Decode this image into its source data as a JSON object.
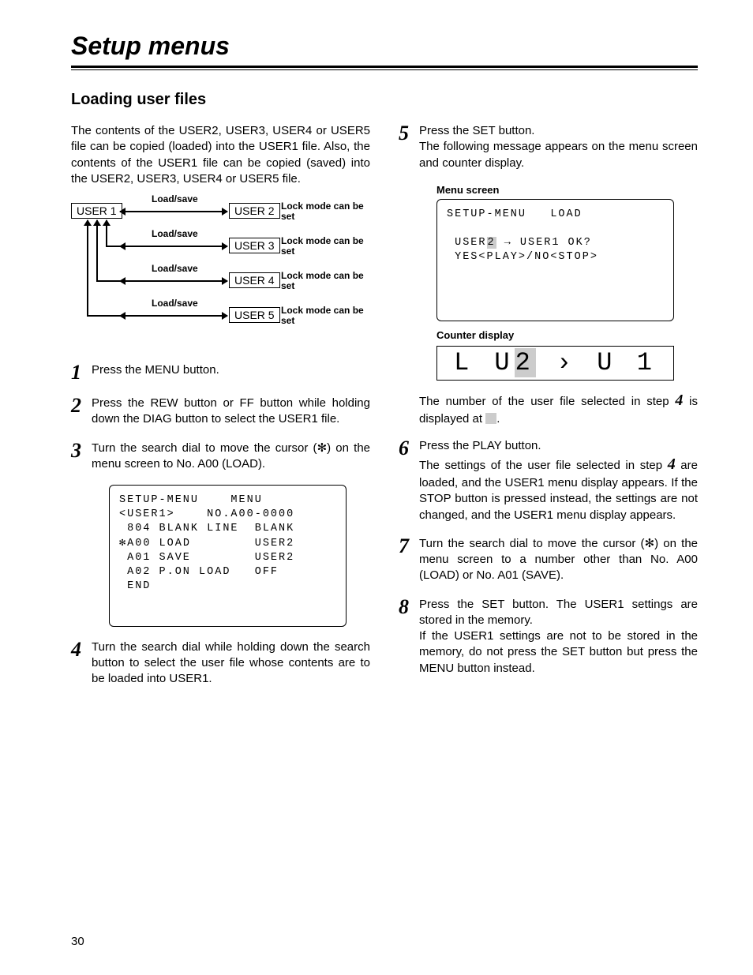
{
  "page": {
    "title": "Setup menus",
    "section": "Loading user files",
    "intro": "The contents of the USER2, USER3, USER4 or USER5 file can be copied (loaded) into the USER1 file. Also, the contents of the USER1 file can be copied (saved) into the USER2, USER3, USER4 or USER5 file.",
    "number": "30"
  },
  "diagram": {
    "user1": "USER 1",
    "users": [
      "USER 2",
      "USER 3",
      "USER 4",
      "USER 5"
    ],
    "loadsave": "Load/save",
    "lock": "Lock mode can be set"
  },
  "steps_left": {
    "s1": "Press the MENU button.",
    "s2": "Press the REW button or FF button while holding down the DIAG button to select the USER1 file.",
    "s3_a": "Turn the search dial to move the cursor (",
    "s3_b": ") on the menu screen to No. A00 (LOAD).",
    "s4": "Turn the search dial while holding down the search button to select the user file whose contents are to be loaded into USER1."
  },
  "menu1": {
    "l1": "SETUP-MENU    MENU",
    "l2": "<USER1>    NO.A00-0000",
    "l3": " 804 BLANK LINE  BLANK",
    "l4": "✻A00 LOAD        USER2",
    "l5": " A01 SAVE        USER2",
    "l6": " A02 P.ON LOAD   OFF",
    "l7": " END"
  },
  "steps_right": {
    "s5a": "Press the SET button.",
    "s5b": "The following message appears on the menu screen and counter display.",
    "menu_label": "Menu screen",
    "counter_label": "Counter display",
    "s5c_a": "The number of the user file selected in step ",
    "s5c_b": " is displayed at ",
    "s5c_c": ".",
    "s6a": "Press the PLAY button.",
    "s6b_a": "The settings of the user file selected in step ",
    "s6b_b": " are loaded, and the USER1 menu display appears. If the STOP button is pressed instead, the settings are not changed, and the USER1 menu display appears.",
    "s7_a": "Turn the search dial to move the cursor (",
    "s7_b": ") on the menu screen to a number other than No. A00 (LOAD) or No. A01 (SAVE).",
    "s8a": "Press the SET button. The USER1 settings are stored in the memory.",
    "s8b": "If the USER1 settings are not to be stored in the memory, do not press the SET button but press the MENU button instead."
  },
  "menu2": {
    "l1": "SETUP-MENU   LOAD",
    "l2a": " USER",
    "l2b": "2",
    "l2c": " → USER1 OK?",
    "l3": " YES<PLAY>/NO<STOP>"
  },
  "counter": {
    "left": "L",
    "mid_a": "U",
    "mid_b": "2",
    "arrow": "›",
    "right": "U 1"
  }
}
